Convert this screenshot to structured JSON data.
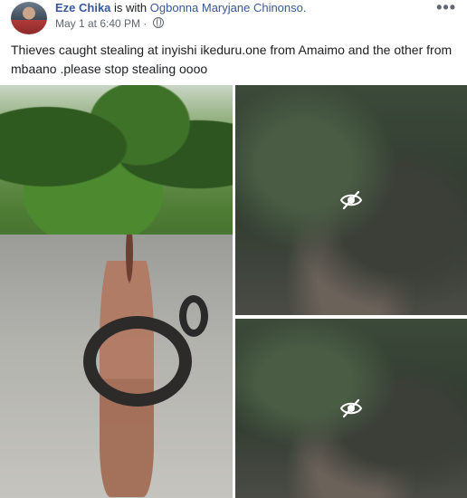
{
  "post": {
    "author": "Eze Chika",
    "with_text": " is with ",
    "tagged": "Ogbonna Maryjane Chinonso.",
    "timestamp": "May 1 at 6:40 PM",
    "separator": " · ",
    "privacy_icon": "globe-icon",
    "more_icon": "more-options-icon",
    "caption": "Thieves caught stealing at inyishi ikeduru.one from Amaimo and the other from mbaano .please stop stealing oooo"
  },
  "media": {
    "hidden_icon": "eye-slash-icon"
  },
  "colors": {
    "link": "#385898",
    "meta": "#606770",
    "text": "#1c1e21"
  }
}
